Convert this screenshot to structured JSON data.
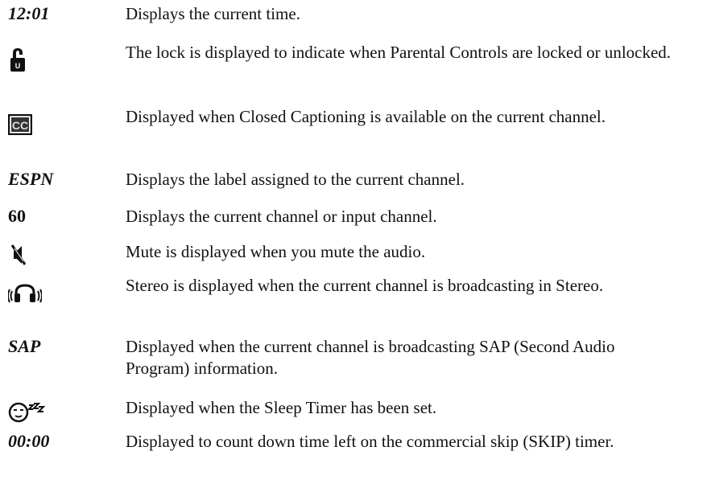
{
  "rows": [
    {
      "indicator": "12:01",
      "icon": "",
      "description": "Displays the current time."
    },
    {
      "indicator": "",
      "icon": "lock-icon",
      "description": "The lock is displayed to indicate when Parental Controls are locked or unlocked."
    },
    {
      "indicator": "",
      "icon": "closed-captioning-icon",
      "description": "Displayed when Closed Captioning is available on the current channel."
    },
    {
      "indicator": "ESPN",
      "icon": "",
      "description": "Displays the label assigned to the current channel."
    },
    {
      "indicator": "60",
      "icon": "",
      "description": "Displays the current channel or input channel."
    },
    {
      "indicator": "",
      "icon": "mute-icon",
      "description": "Mute is displayed when you mute the audio."
    },
    {
      "indicator": "",
      "icon": "stereo-icon",
      "description": "Stereo is displayed when the current channel is broadcasting in Stereo."
    },
    {
      "indicator": "SAP",
      "icon": "",
      "description": "Displayed when the current channel is broadcasting SAP (Second Audio Program) information."
    },
    {
      "indicator": "",
      "icon": "sleep-timer-icon",
      "description": "Displayed when the Sleep Timer has been set."
    },
    {
      "indicator": "00:00",
      "icon": "",
      "description": "Displayed to count down time left on the commercial skip (SKIP) timer."
    }
  ],
  "cc_icon_text": "CC"
}
